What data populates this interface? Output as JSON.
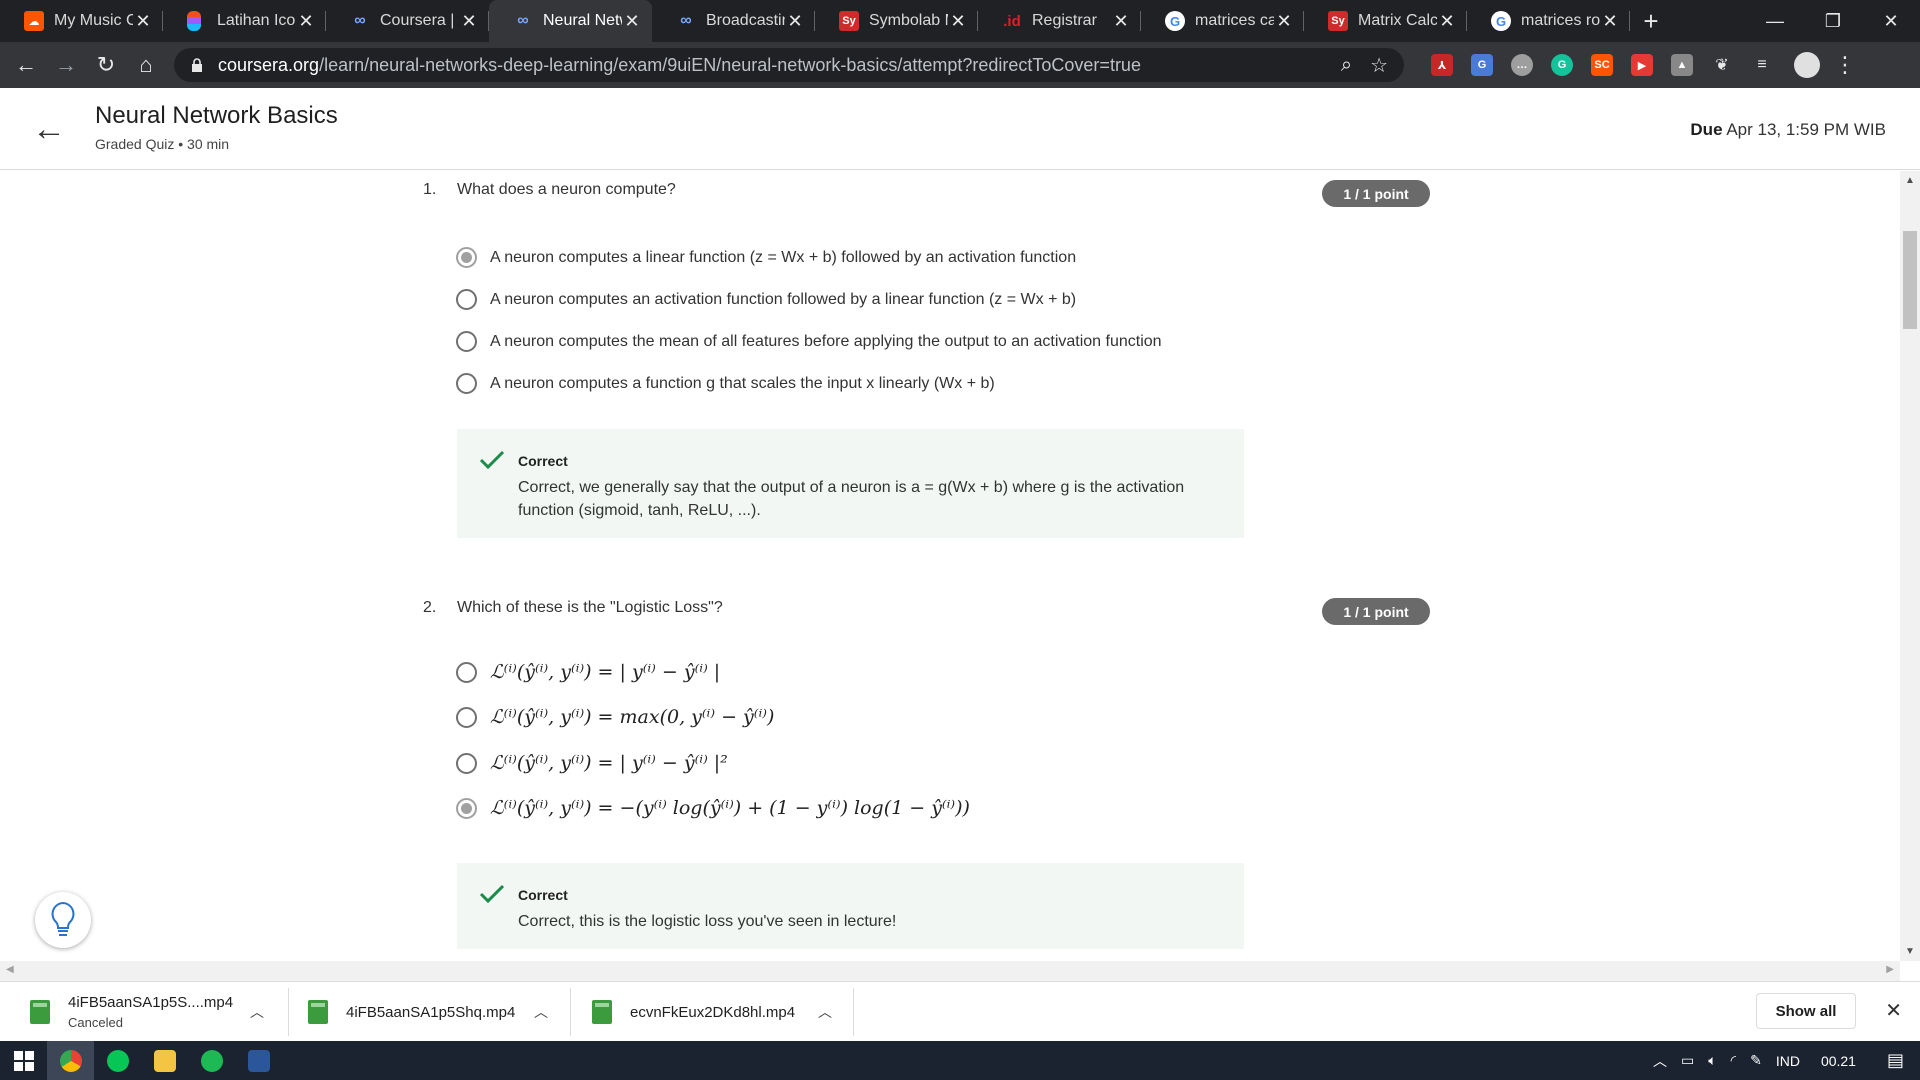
{
  "browser": {
    "tabs": [
      {
        "title": "My Music Co",
        "icon": "soundcloud-icon",
        "color": "#ff5500",
        "active": false
      },
      {
        "title": "Latihan Icon",
        "icon": "figma-icon",
        "color": "#f24e1e",
        "active": false
      },
      {
        "title": "Coursera | O",
        "icon": "coursera-icon",
        "color": "#7aa7ff",
        "active": false
      },
      {
        "title": "Neural Netw",
        "icon": "coursera-icon",
        "color": "#7aa7ff",
        "active": true
      },
      {
        "title": "Broadcasting",
        "icon": "coursera-icon",
        "color": "#7aa7ff",
        "active": false
      },
      {
        "title": "Symbolab M",
        "icon": "symbolab-icon",
        "color": "#d02b2b",
        "active": false
      },
      {
        "title": "Registrar",
        "icon": "id-registrar-icon",
        "color": "#e01f26",
        "active": false
      },
      {
        "title": "matrices calc",
        "icon": "google-icon",
        "color": "#ffffff",
        "active": false
      },
      {
        "title": "Matrix Calcu",
        "icon": "symbolab-icon",
        "color": "#d02b2b",
        "active": false
      },
      {
        "title": "matrices row",
        "icon": "google-icon",
        "color": "#ffffff",
        "active": false
      }
    ],
    "url_domain": "coursera.org",
    "url_path": "/learn/neural-networks-deep-learning/exam/9uiEN/neural-network-basics/attempt?redirectToCover=true"
  },
  "header": {
    "title": "Neural Network Basics",
    "subtitle": "Graded Quiz • 30 min",
    "due_label": "Due",
    "due_value": " Apr 13, 1:59 PM WIB"
  },
  "questions": [
    {
      "number": "1.",
      "text": "What does a neuron compute?",
      "points": "1 / 1 point",
      "options": [
        {
          "text": "A neuron computes a linear function (z = Wx + b) followed by an activation function",
          "selected": true
        },
        {
          "text": "A neuron computes an activation function followed by a linear function (z = Wx + b)",
          "selected": false
        },
        {
          "text": "A neuron computes the mean of all features before applying the output to an activation function",
          "selected": false
        },
        {
          "text": "A neuron computes a function g that scales the input x linearly (Wx + b)",
          "selected": false
        }
      ],
      "feedback_title": "Correct",
      "feedback_text": "Correct, we generally say that the output of a neuron is a = g(Wx + b) where g is the activation function (sigmoid, tanh, ReLU, ...)."
    },
    {
      "number": "2.",
      "text": "Which of these is the \"Logistic Loss\"?",
      "points": "1 / 1 point",
      "options": [
        {
          "text": "ℒ⁽ⁱ⁾(ŷ⁽ⁱ⁾, y⁽ⁱ⁾) = | y⁽ⁱ⁾ − ŷ⁽ⁱ⁾ |",
          "selected": false
        },
        {
          "text": "ℒ⁽ⁱ⁾(ŷ⁽ⁱ⁾, y⁽ⁱ⁾) = max(0, y⁽ⁱ⁾ − ŷ⁽ⁱ⁾)",
          "selected": false
        },
        {
          "text": "ℒ⁽ⁱ⁾(ŷ⁽ⁱ⁾, y⁽ⁱ⁾) = | y⁽ⁱ⁾ − ŷ⁽ⁱ⁾ |²",
          "selected": false
        },
        {
          "text": "ℒ⁽ⁱ⁾(ŷ⁽ⁱ⁾, y⁽ⁱ⁾) = −(y⁽ⁱ⁾ log(ŷ⁽ⁱ⁾) + (1 − y⁽ⁱ⁾) log(1 − ŷ⁽ⁱ⁾))",
          "selected": true
        }
      ],
      "feedback_title": "Correct",
      "feedback_text": "Correct, this is the logistic loss you've seen in lecture!"
    }
  ],
  "downloads": {
    "items": [
      {
        "name": "4iFB5aanSA1p5S....mp4",
        "status": "Canceled"
      },
      {
        "name": "4iFB5aanSA1p5Shq.mp4",
        "status": ""
      },
      {
        "name": "ecvnFkEux2DKd8hl.mp4",
        "status": ""
      }
    ],
    "show_all": "Show all"
  },
  "taskbar": {
    "lang": "IND",
    "time": "00.21"
  },
  "colors": {
    "accent_check": "#1b8a4b",
    "points_badge": "#6a6a6a",
    "feedback_bg": "#f2f7f4"
  }
}
